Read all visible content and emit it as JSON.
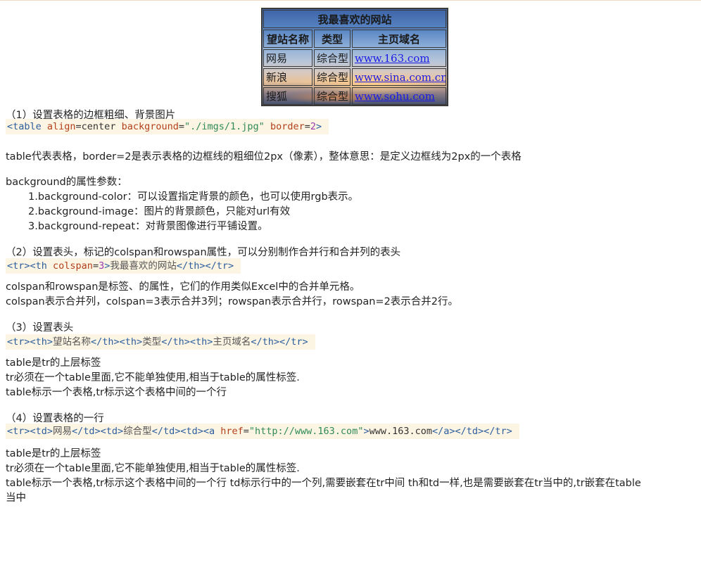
{
  "demo_table": {
    "caption": "我最喜欢的网站",
    "headers": [
      "望站名称",
      "类型",
      "主页域名"
    ],
    "rows": [
      {
        "name": "网易",
        "type": "综合型",
        "link": "www.163.com"
      },
      {
        "name": "新浪",
        "type": "综合型",
        "link": "www.sina.com.cn"
      },
      {
        "name": "搜狐",
        "type": "综合型",
        "link": "www.sohu.com"
      }
    ]
  },
  "section1": {
    "heading": "（1）设置表格的边框粗细、背景图片",
    "code": {
      "open": "<table ",
      "attr1": "align",
      "eq1": "=center ",
      "attr2": "background",
      "eq2": "=",
      "val2": "\"./imgs/1.jpg\"",
      "sp": " ",
      "attr3": "border",
      "eq3": "=",
      "val3": "2",
      "close": ">"
    },
    "desc": "table代表表格，border=2是表示表格的边框线的粗细位2px（像素），整体意思：是定义边框线为2px的一个表格",
    "bg_title": "background的属性参数：",
    "bg_items": [
      "1.background-color：可以设置指定背景的颜色，也可以使用rgb表示。",
      "2.background-image：图片的背景颜色，只能对url有效",
      "3.background-repeat：对背景图像进行平铺设置。"
    ]
  },
  "section2": {
    "heading": "（2）设置表头，标记的colspan和rowspan属性，可以分别制作合并行和合并列的表头",
    "code": {
      "open": "<tr><th ",
      "attr": "colspan",
      "eq": "=",
      "val": "3",
      "gt": ">",
      "text": "我最喜欢的网站",
      "close": "</th></tr>"
    },
    "desc1": "colspan和rowspan是标签、的属性，它们的作用类似Excel中的合并单元格。",
    "desc2": "colspan表示合并列，colspan=3表示合并3列；rowspan表示合并行，rowspan=2表示合并2行。"
  },
  "section3": {
    "heading": "（3）设置表头",
    "code": {
      "t1": "<tr><th>",
      "x1": "望站名称",
      "t2": "</th><th>",
      "x2": "类型",
      "t3": "</th><th>",
      "x3": "主页域名",
      "t4": "</th></tr>"
    },
    "lines": [
      "table是tr的上层标签",
      "tr必须在一个table里面,它不能单独使用,相当于table的属性标签.",
      "table标示一个表格,tr标示这个表格中间的一个行"
    ]
  },
  "section4": {
    "heading": "（4）设置表格的一行",
    "code": {
      "t1": "<tr><td>",
      "x1": "网易",
      "t2": "</td><td>",
      "x2": "综合型",
      "t3": "</td><td><a ",
      "attr": "href",
      "eq": "=",
      "val": "\"http://www.163.com\"",
      "gt": ">",
      "x3": "www.163.com",
      "t4": "</a></td></tr>"
    },
    "lines": [
      "table是tr的上层标签",
      "tr必须在一个table里面,它不能单独使用,相当于table的属性标签.",
      "table标示一个表格,tr标示这个表格中间的一个行 td标示行中的一个列,需要嵌套在tr中间 th和td一样,也是需要嵌套在tr当中的,tr嵌套在table",
      "当中"
    ]
  }
}
